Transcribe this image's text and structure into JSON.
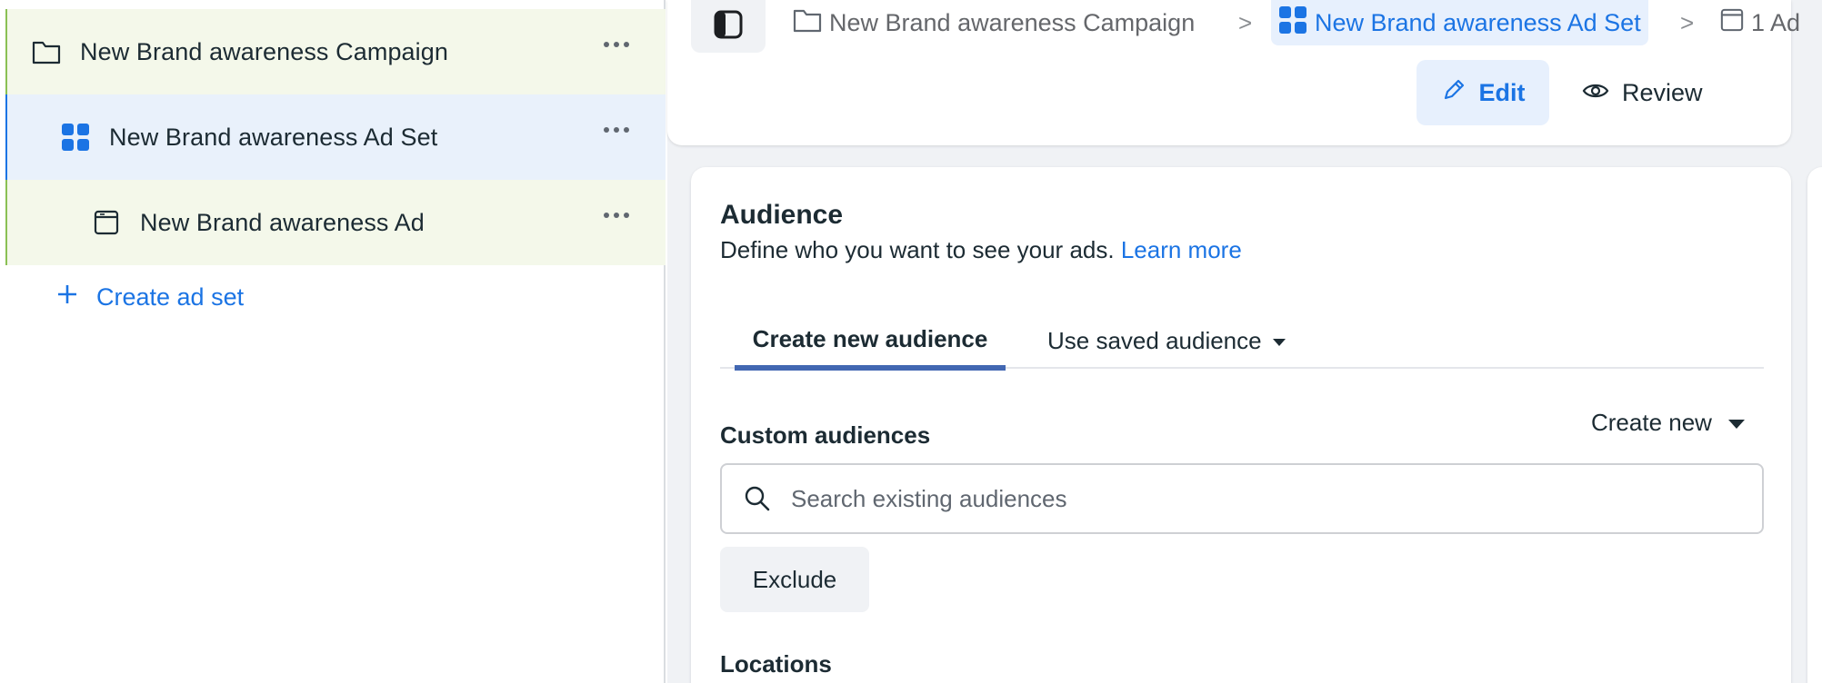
{
  "tree": {
    "campaign": {
      "label": "New Brand awareness Campaign",
      "icon": "folder-icon"
    },
    "adset": {
      "label": "New Brand awareness Ad Set",
      "icon": "grid-icon"
    },
    "ad": {
      "label": "New Brand awareness Ad",
      "icon": "ad-page-icon"
    },
    "create_adset": "Create ad set"
  },
  "breadcrumb": {
    "campaign": "New Brand awareness Campaign",
    "adset": "New Brand awareness Ad Set",
    "ad": "1 Ad",
    "separator": ">"
  },
  "toolbar": {
    "edit_label": "Edit",
    "review_label": "Review"
  },
  "audience": {
    "title": "Audience",
    "subtitle": "Define who you want to see your ads.",
    "learn_more": "Learn more",
    "tabs": [
      {
        "label": "Create new audience",
        "active": true
      },
      {
        "label": "Use saved audience",
        "active": false
      }
    ],
    "custom_audiences_label": "Custom audiences",
    "create_new_label": "Create new",
    "search_placeholder": "Search existing audiences",
    "exclude_label": "Exclude",
    "next_section_label": "Locations"
  },
  "colors": {
    "accent": "#1b74e4",
    "tab_indicator": "#4267b2",
    "campaign_row_bg": "#f4f8ea",
    "adset_row_bg": "#e9f1fb"
  }
}
